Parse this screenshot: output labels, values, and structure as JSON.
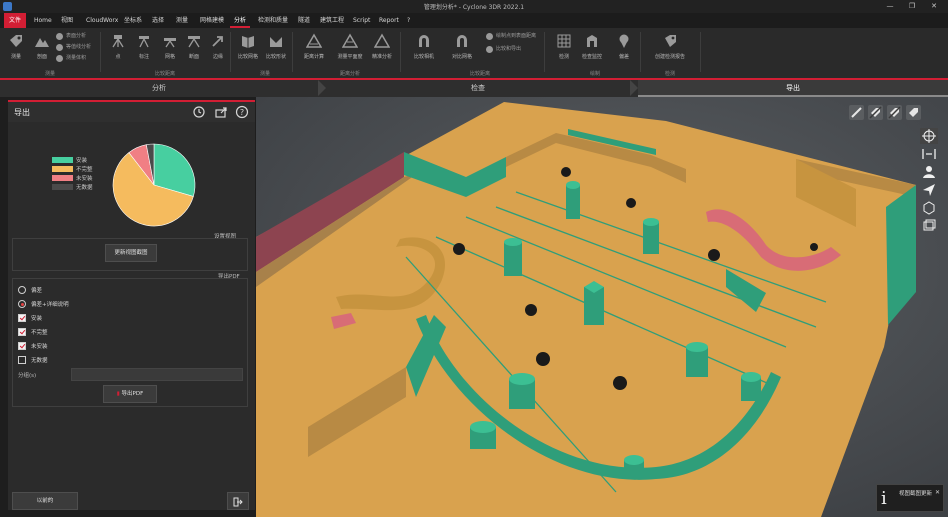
{
  "window": {
    "title": "管理划分析* - Cyclone 3DR 2022.1",
    "minimize": "—",
    "restore": "❐",
    "close": "✕"
  },
  "menu": {
    "items": [
      "文件",
      "Home",
      "视图",
      "CloudWorx",
      "坐标系",
      "选择",
      "测量",
      "网格建模",
      "分析",
      "检测和质量",
      "隧道",
      "建筑工程",
      "Script",
      "Report",
      "?"
    ],
    "active_index": 8
  },
  "ribbon": {
    "groups": [
      "测量",
      "比较距离",
      "测量",
      "距离分析",
      "比较距离",
      "绘制",
      "检测"
    ],
    "buttons": [
      "测量",
      "剖面",
      "点",
      "标注",
      "网格",
      "断面",
      "边缘",
      "比较网格",
      "比较形状",
      "距离计算",
      "测量平面度",
      "精准分析",
      "比较相机",
      "对比网格",
      "检测",
      "检查监控",
      "偏差",
      "创建检测报告"
    ],
    "small_items": [
      "表面分析",
      "等值线分析",
      "测量体积",
      "绘制点到表面距离",
      "比较和导出"
    ]
  },
  "workflow": {
    "steps": [
      "分析",
      "检查",
      "导出"
    ],
    "active_index": 2
  },
  "panel": {
    "title": "导出",
    "legend": [
      {
        "label": "安装",
        "color": "#47cfa0"
      },
      {
        "label": "不完整",
        "color": "#f5bb5e"
      },
      {
        "label": "未安装",
        "color": "#f07f84"
      },
      {
        "label": "无数据",
        "color": "#4a4a4a"
      }
    ],
    "pie_fractions": [
      0.295,
      0.6,
      0.075,
      0.03
    ],
    "section_view": "设置视图",
    "update_view_btn": "更新视图截图",
    "section_export": "导出PDF",
    "radio_options": [
      {
        "label": "偏差",
        "checked": false
      },
      {
        "label": "偏差+详细说明",
        "checked": true
      }
    ],
    "check_options": [
      {
        "label": "安装",
        "checked": true
      },
      {
        "label": "不完整",
        "checked": true
      },
      {
        "label": "未安装",
        "checked": true
      },
      {
        "label": "无数据",
        "checked": false
      }
    ],
    "sub_label": "分组(s)",
    "export_btn": "导出PDF",
    "footer_btn": "以前的"
  },
  "notification": {
    "icon": "i",
    "text": "视图截图更新",
    "close": "✕"
  },
  "colors": {
    "accent": "#d21e34",
    "installed": "#2f9e7a",
    "incomplete": "#d9a24e",
    "not_installed": "#d86c76",
    "wall_red": "#8d4450"
  }
}
